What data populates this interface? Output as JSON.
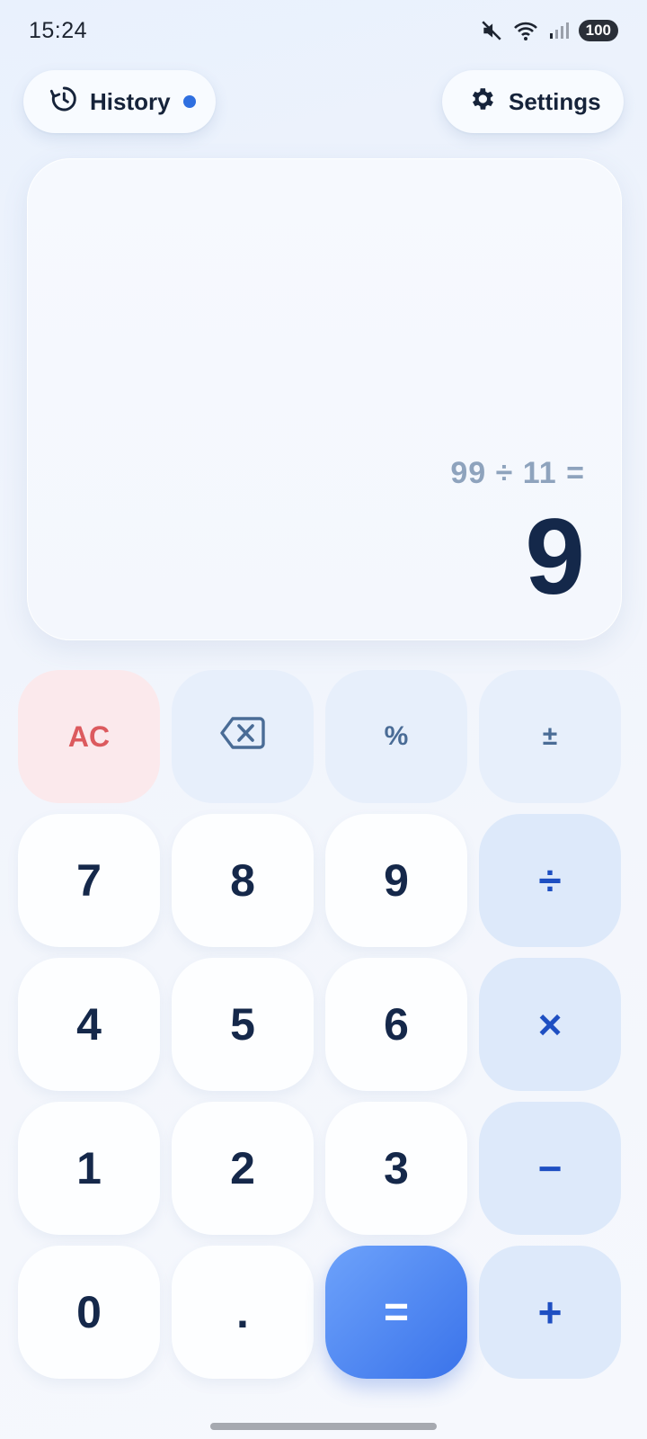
{
  "status_bar": {
    "time": "15:24",
    "battery": "100",
    "icons": [
      "mute-icon",
      "wifi-icon",
      "signal-icon",
      "battery-icon"
    ]
  },
  "header": {
    "history_label": "History",
    "settings_label": "Settings",
    "history_indicator_color": "#2f6fe0"
  },
  "display": {
    "expression": "99 ÷ 11 =",
    "result": "9"
  },
  "keypad": {
    "ac": "AC",
    "backspace_icon": "backspace-icon",
    "percent": "%",
    "sign": "±",
    "seven": "7",
    "eight": "8",
    "nine": "9",
    "divide": "÷",
    "four": "4",
    "five": "5",
    "six": "6",
    "multiply": "×",
    "one": "1",
    "two": "2",
    "three": "3",
    "minus": "−",
    "zero": "0",
    "decimal": ".",
    "equals": "=",
    "plus": "+"
  },
  "colors": {
    "accent": "#3a73ea",
    "ac_text": "#dc5a5e",
    "operator_text": "#1e4fc2",
    "digit_text": "#15284a"
  }
}
